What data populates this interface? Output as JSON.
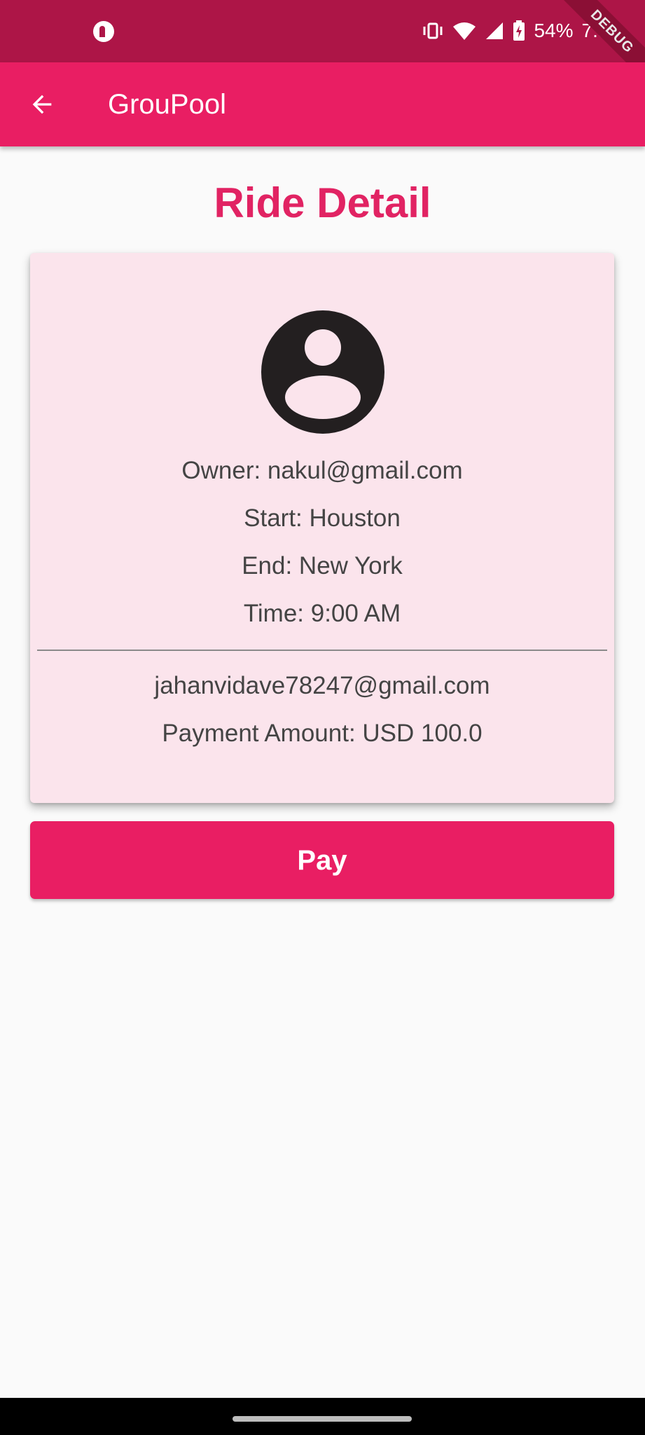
{
  "status_bar": {
    "battery": "54%",
    "time": "7:38",
    "debug_label": "DEBUG"
  },
  "app_bar": {
    "title": "GrouPool"
  },
  "page": {
    "title": "Ride Detail"
  },
  "ride": {
    "owner": "Owner: nakul@gmail.com",
    "start": "Start: Houston",
    "end": "End: New York",
    "time": "Time: 9:00 AM",
    "rider_email": "jahanvidave78247@gmail.com",
    "payment": "Payment Amount: USD 100.0"
  },
  "actions": {
    "pay_label": "Pay"
  },
  "colors": {
    "primary": "#e91e63",
    "status_bar": "#ad1547",
    "card_bg": "#fbe4ec"
  }
}
